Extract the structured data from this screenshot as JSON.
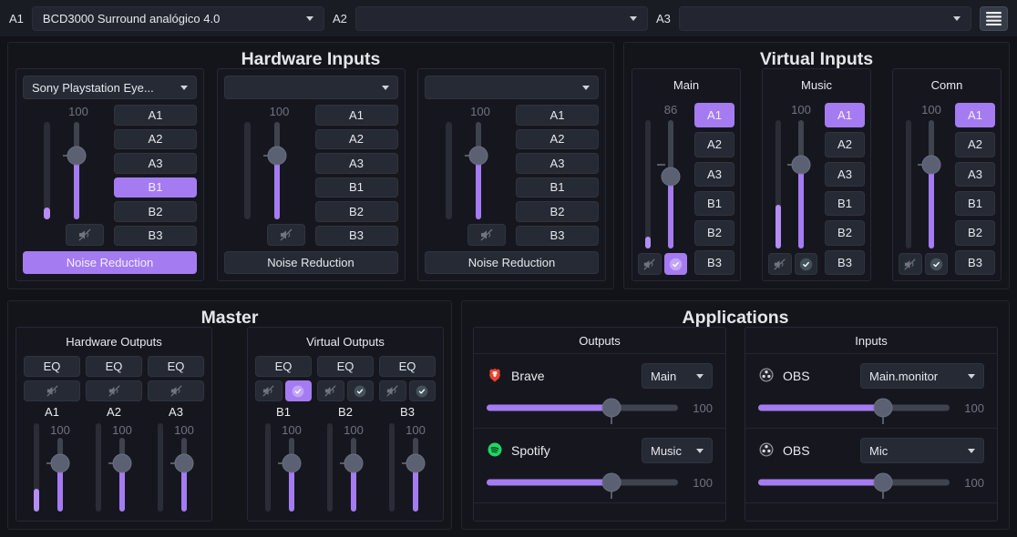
{
  "topbar": {
    "outputs": [
      {
        "label": "A1",
        "value": "BCD3000 Surround analógico 4.0"
      },
      {
        "label": "A2",
        "value": ""
      },
      {
        "label": "A3",
        "value": ""
      }
    ]
  },
  "accent_color": "#a57bf2",
  "hardware_inputs": {
    "title": "Hardware Inputs",
    "cards": [
      {
        "device": "Sony Playstation Eye...",
        "volume": "100",
        "slider_fill": "65%",
        "meter_fill": "12%",
        "mute_active": false,
        "routes": [
          {
            "label": "A1",
            "active": false
          },
          {
            "label": "A2",
            "active": false
          },
          {
            "label": "A3",
            "active": false
          },
          {
            "label": "B1",
            "active": true
          },
          {
            "label": "B2",
            "active": false
          },
          {
            "label": "B3",
            "active": false
          }
        ],
        "noise_reduction": {
          "label": "Noise Reduction",
          "active": true
        }
      },
      {
        "device": "",
        "volume": "100",
        "slider_fill": "65%",
        "meter_fill": "0%",
        "mute_active": false,
        "routes": [
          {
            "label": "A1",
            "active": false
          },
          {
            "label": "A2",
            "active": false
          },
          {
            "label": "A3",
            "active": false
          },
          {
            "label": "B1",
            "active": false
          },
          {
            "label": "B2",
            "active": false
          },
          {
            "label": "B3",
            "active": false
          }
        ],
        "noise_reduction": {
          "label": "Noise Reduction",
          "active": false
        }
      },
      {
        "device": "",
        "volume": "100",
        "slider_fill": "65%",
        "meter_fill": "0%",
        "mute_active": false,
        "routes": [
          {
            "label": "A1",
            "active": false
          },
          {
            "label": "A2",
            "active": false
          },
          {
            "label": "A3",
            "active": false
          },
          {
            "label": "B1",
            "active": false
          },
          {
            "label": "B2",
            "active": false
          },
          {
            "label": "B3",
            "active": false
          }
        ],
        "noise_reduction": {
          "label": "Noise Reduction",
          "active": false
        }
      }
    ]
  },
  "virtual_inputs": {
    "title": "Virtual Inputs",
    "cards": [
      {
        "name": "Main",
        "volume": "86",
        "slider_fill": "56%",
        "meter_fill": "9%",
        "mute_active": false,
        "primary_active": true,
        "routes": [
          {
            "label": "A1",
            "active": true
          },
          {
            "label": "A2",
            "active": false
          },
          {
            "label": "A3",
            "active": false
          },
          {
            "label": "B1",
            "active": false
          },
          {
            "label": "B2",
            "active": false
          },
          {
            "label": "B3",
            "active": false
          }
        ]
      },
      {
        "name": "Music",
        "volume": "100",
        "slider_fill": "65%",
        "meter_fill": "34%",
        "mute_active": false,
        "primary_active": false,
        "routes": [
          {
            "label": "A1",
            "active": true
          },
          {
            "label": "A2",
            "active": false
          },
          {
            "label": "A3",
            "active": false
          },
          {
            "label": "B1",
            "active": false
          },
          {
            "label": "B2",
            "active": false
          },
          {
            "label": "B3",
            "active": false
          }
        ]
      },
      {
        "name": "Comn",
        "volume": "100",
        "slider_fill": "65%",
        "meter_fill": "0%",
        "mute_active": false,
        "primary_active": false,
        "routes": [
          {
            "label": "A1",
            "active": true
          },
          {
            "label": "A2",
            "active": false
          },
          {
            "label": "A3",
            "active": false
          },
          {
            "label": "B1",
            "active": false
          },
          {
            "label": "B2",
            "active": false
          },
          {
            "label": "B3",
            "active": false
          }
        ]
      }
    ]
  },
  "master": {
    "title": "Master",
    "hardware_outputs": {
      "title": "Hardware Outputs",
      "channels": [
        {
          "label": "A1",
          "eq_label": "EQ",
          "volume": "100",
          "slider_fill": "65%",
          "meter_fill": "26%",
          "mute_active": false
        },
        {
          "label": "A2",
          "eq_label": "EQ",
          "volume": "100",
          "slider_fill": "65%",
          "meter_fill": "0%",
          "mute_active": false
        },
        {
          "label": "A3",
          "eq_label": "EQ",
          "volume": "100",
          "slider_fill": "65%",
          "meter_fill": "0%",
          "mute_active": false
        }
      ]
    },
    "virtual_outputs": {
      "title": "Virtual Outputs",
      "channels": [
        {
          "label": "B1",
          "eq_label": "EQ",
          "volume": "100",
          "slider_fill": "65%",
          "meter_fill": "0%",
          "mute_active": false,
          "primary_active": true
        },
        {
          "label": "B2",
          "eq_label": "EQ",
          "volume": "100",
          "slider_fill": "65%",
          "meter_fill": "0%",
          "mute_active": false,
          "primary_active": false
        },
        {
          "label": "B3",
          "eq_label": "EQ",
          "volume": "100",
          "slider_fill": "65%",
          "meter_fill": "0%",
          "mute_active": false,
          "primary_active": false
        }
      ]
    }
  },
  "applications": {
    "title": "Applications",
    "outputs": {
      "title": "Outputs",
      "apps": [
        {
          "name": "Brave",
          "icon": "brave-icon",
          "target": "Main",
          "volume": "100",
          "slider_fill": "65%"
        },
        {
          "name": "Spotify",
          "icon": "spotify-icon",
          "target": "Music",
          "volume": "100",
          "slider_fill": "65%"
        }
      ]
    },
    "inputs": {
      "title": "Inputs",
      "apps": [
        {
          "name": "OBS",
          "icon": "obs-icon",
          "target": "Main.monitor",
          "volume": "100",
          "slider_fill": "65%"
        },
        {
          "name": "OBS",
          "icon": "obs-icon",
          "target": "Mic",
          "volume": "100",
          "slider_fill": "65%"
        }
      ]
    }
  }
}
